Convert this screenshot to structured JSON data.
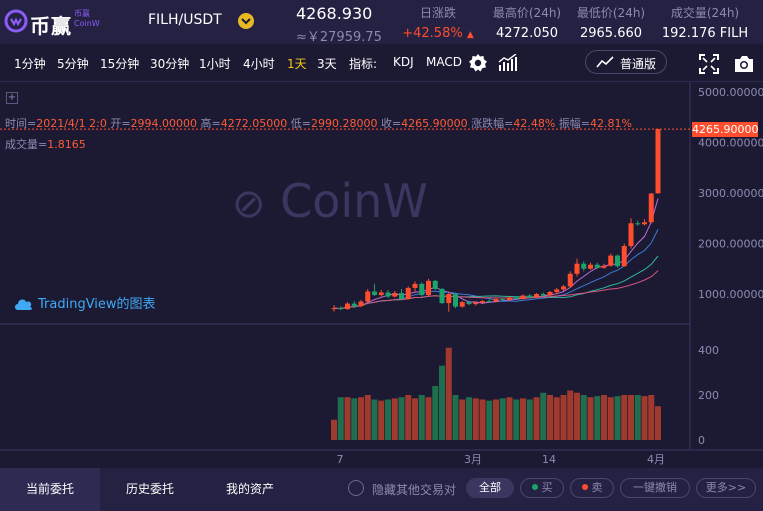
{
  "header": {
    "logo_text": "币赢",
    "logo_sub": "币赢CoinW",
    "pair": "FILH/USDT",
    "last_price": "4268.930",
    "last_price_cny": "≈￥27959.75",
    "stats": [
      {
        "label": "日涨跌",
        "value": "+42.58%",
        "up": true
      },
      {
        "label": "最高价(24h)",
        "value": "4272.050"
      },
      {
        "label": "最低价(24h)",
        "value": "2965.660"
      },
      {
        "label": "成交量(24h)",
        "value": "192.176 FILH"
      }
    ]
  },
  "toolbar": {
    "intervals": [
      "1分钟",
      "5分钟",
      "15分钟",
      "30分钟",
      "1小时",
      "4小时",
      "1天",
      "3天"
    ],
    "active_interval": "1天",
    "indicators_label": "指标:",
    "indicators": [
      "KDJ",
      "MACD"
    ],
    "standard_label": "普通版"
  },
  "chart_info": {
    "time_label": "时间=",
    "time_value": "2021/4/1 2:0",
    "open_label": "开=",
    "open_value": "2994.00000",
    "high_label": "高=",
    "high_value": "4272.05000",
    "low_label": "低=",
    "low_value": "2990.28000",
    "close_label": "收=",
    "close_value": "4265.90000",
    "change_label": "涨跌幅=",
    "change_value": "42.48%",
    "amp_label": "振幅=",
    "amp_value": "42.81%",
    "vol_label": "成交量=",
    "vol_value": "1.8165",
    "watermark": "CoinW",
    "tv_label": "TradingView的图表",
    "current_price_tag": "4265.90000"
  },
  "chart_data": {
    "type": "candlestick",
    "price_axis": [
      "5000.00000",
      "4000.00000",
      "3000.00000",
      "2000.00000",
      "1000.00000"
    ],
    "price_ticks": [
      5000,
      4000,
      3000,
      2000,
      1000
    ],
    "volume_axis": [
      "400",
      "200",
      "0"
    ],
    "volume_ticks": [
      400,
      200,
      0
    ],
    "x_axis": [
      "7",
      "3月",
      "14",
      "4月"
    ],
    "colors": {
      "up": "#ff4d2e",
      "down": "#1aa36b",
      "up_vol": "#a03a2e",
      "down_vol": "#1f6e4e"
    },
    "candles": [
      {
        "o": 700,
        "h": 780,
        "l": 650,
        "c": 720,
        "v": 90
      },
      {
        "o": 720,
        "h": 760,
        "l": 680,
        "c": 700,
        "v": 190
      },
      {
        "o": 700,
        "h": 840,
        "l": 690,
        "c": 810,
        "v": 190
      },
      {
        "o": 810,
        "h": 860,
        "l": 720,
        "c": 760,
        "v": 185
      },
      {
        "o": 760,
        "h": 880,
        "l": 740,
        "c": 850,
        "v": 190
      },
      {
        "o": 850,
        "h": 1100,
        "l": 840,
        "c": 1050,
        "v": 200
      },
      {
        "o": 1050,
        "h": 1200,
        "l": 960,
        "c": 980,
        "v": 180
      },
      {
        "o": 980,
        "h": 1080,
        "l": 950,
        "c": 1030,
        "v": 175
      },
      {
        "o": 1030,
        "h": 1080,
        "l": 920,
        "c": 950,
        "v": 180
      },
      {
        "o": 950,
        "h": 1060,
        "l": 930,
        "c": 1020,
        "v": 185
      },
      {
        "o": 1020,
        "h": 1100,
        "l": 880,
        "c": 900,
        "v": 190
      },
      {
        "o": 900,
        "h": 1150,
        "l": 890,
        "c": 1120,
        "v": 200
      },
      {
        "o": 1120,
        "h": 1250,
        "l": 1050,
        "c": 1200,
        "v": 185
      },
      {
        "o": 1200,
        "h": 1230,
        "l": 950,
        "c": 980,
        "v": 200
      },
      {
        "o": 980,
        "h": 1300,
        "l": 960,
        "c": 1260,
        "v": 190
      },
      {
        "o": 1260,
        "h": 1280,
        "l": 1080,
        "c": 1100,
        "v": 240
      },
      {
        "o": 1100,
        "h": 1120,
        "l": 800,
        "c": 820,
        "v": 330
      },
      {
        "o": 820,
        "h": 1050,
        "l": 650,
        "c": 1000,
        "v": 410
      },
      {
        "o": 1000,
        "h": 1020,
        "l": 720,
        "c": 750,
        "v": 200
      },
      {
        "o": 750,
        "h": 860,
        "l": 730,
        "c": 840,
        "v": 180
      },
      {
        "o": 840,
        "h": 870,
        "l": 780,
        "c": 800,
        "v": 190
      },
      {
        "o": 800,
        "h": 850,
        "l": 770,
        "c": 830,
        "v": 185
      },
      {
        "o": 830,
        "h": 880,
        "l": 800,
        "c": 860,
        "v": 180
      },
      {
        "o": 860,
        "h": 900,
        "l": 830,
        "c": 850,
        "v": 175
      },
      {
        "o": 850,
        "h": 920,
        "l": 840,
        "c": 900,
        "v": 180
      },
      {
        "o": 900,
        "h": 930,
        "l": 870,
        "c": 880,
        "v": 185
      },
      {
        "o": 880,
        "h": 950,
        "l": 860,
        "c": 930,
        "v": 190
      },
      {
        "o": 930,
        "h": 960,
        "l": 880,
        "c": 900,
        "v": 180
      },
      {
        "o": 900,
        "h": 990,
        "l": 890,
        "c": 970,
        "v": 185
      },
      {
        "o": 970,
        "h": 1000,
        "l": 910,
        "c": 930,
        "v": 180
      },
      {
        "o": 930,
        "h": 1020,
        "l": 920,
        "c": 1000,
        "v": 190
      },
      {
        "o": 1000,
        "h": 1030,
        "l": 950,
        "c": 970,
        "v": 210
      },
      {
        "o": 970,
        "h": 1060,
        "l": 960,
        "c": 1040,
        "v": 200
      },
      {
        "o": 1040,
        "h": 1120,
        "l": 1000,
        "c": 1090,
        "v": 190
      },
      {
        "o": 1090,
        "h": 1180,
        "l": 1060,
        "c": 1150,
        "v": 200
      },
      {
        "o": 1150,
        "h": 1450,
        "l": 1120,
        "c": 1400,
        "v": 220
      },
      {
        "o": 1400,
        "h": 1700,
        "l": 1350,
        "c": 1600,
        "v": 210
      },
      {
        "o": 1600,
        "h": 1650,
        "l": 1450,
        "c": 1500,
        "v": 200
      },
      {
        "o": 1500,
        "h": 1620,
        "l": 1480,
        "c": 1580,
        "v": 190
      },
      {
        "o": 1580,
        "h": 1620,
        "l": 1500,
        "c": 1520,
        "v": 195
      },
      {
        "o": 1520,
        "h": 1600,
        "l": 1500,
        "c": 1560,
        "v": 200
      },
      {
        "o": 1560,
        "h": 1800,
        "l": 1540,
        "c": 1760,
        "v": 190
      },
      {
        "o": 1760,
        "h": 1780,
        "l": 1520,
        "c": 1550,
        "v": 195
      },
      {
        "o": 1550,
        "h": 2000,
        "l": 1540,
        "c": 1950,
        "v": 200
      },
      {
        "o": 1950,
        "h": 2500,
        "l": 1900,
        "c": 2400,
        "v": 200
      },
      {
        "o": 2400,
        "h": 2450,
        "l": 2350,
        "c": 2380,
        "v": 200
      },
      {
        "o": 2380,
        "h": 2480,
        "l": 2360,
        "c": 2420,
        "v": 195
      },
      {
        "o": 2420,
        "h": 3000,
        "l": 2400,
        "c": 2990,
        "v": 200
      },
      {
        "o": 2994,
        "h": 4272,
        "l": 2990,
        "c": 4266,
        "v": 150
      }
    ]
  },
  "footer": {
    "tabs": [
      "当前委托",
      "历史委托",
      "我的资产"
    ],
    "hide_label": "隐藏其他交易对",
    "filters": [
      "全部",
      "买",
      "卖"
    ],
    "cancel_all": "一键撤销",
    "more": "更多>>"
  }
}
